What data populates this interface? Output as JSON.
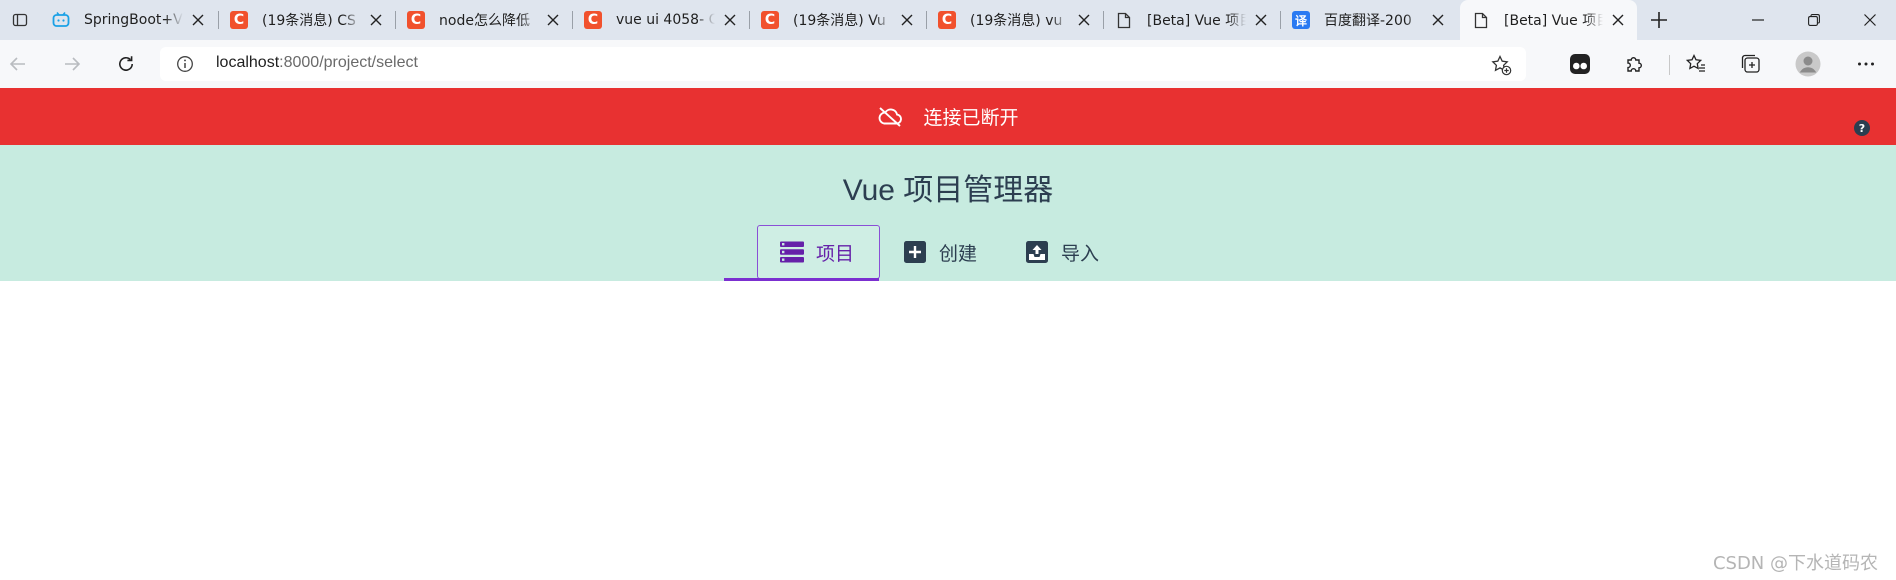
{
  "browser": {
    "tabs": [
      {
        "favicon": "bilibili-icon",
        "title": "SpringBoot+V"
      },
      {
        "favicon": "csdn-icon",
        "favicon_text": "C",
        "title": "(19条消息) CS"
      },
      {
        "favicon": "csdn-icon",
        "favicon_text": "C",
        "title": "node怎么降低"
      },
      {
        "favicon": "csdn-icon",
        "favicon_text": "C",
        "title": "vue ui 4058- C"
      },
      {
        "favicon": "csdn-icon",
        "favicon_text": "C",
        "title": "(19条消息) Vu"
      },
      {
        "favicon": "csdn-icon",
        "favicon_text": "C",
        "title": "(19条消息) vu"
      },
      {
        "favicon": "page-icon",
        "title": "[Beta] Vue 项目"
      },
      {
        "favicon": "baidu-translate-icon",
        "favicon_text": "译",
        "title": "百度翻译-200"
      },
      {
        "favicon": "page-icon",
        "title": "[Beta] Vue 项目",
        "active": true
      }
    ],
    "url": {
      "host": "localhost",
      "rest": ":8000/project/select"
    }
  },
  "banner": {
    "icon": "cloud-off-icon",
    "text": "连接已断开",
    "color": "#e83131"
  },
  "header": {
    "title": "Vue 项目管理器",
    "tabs": [
      {
        "icon": "list-icon",
        "label": "项目",
        "selected": true
      },
      {
        "icon": "add-box-icon",
        "label": "创建"
      },
      {
        "icon": "import-icon",
        "label": "导入"
      }
    ],
    "background": "#c7ebe0",
    "accent": "#6621a9"
  },
  "watermark": "CSDN @下水道码农"
}
